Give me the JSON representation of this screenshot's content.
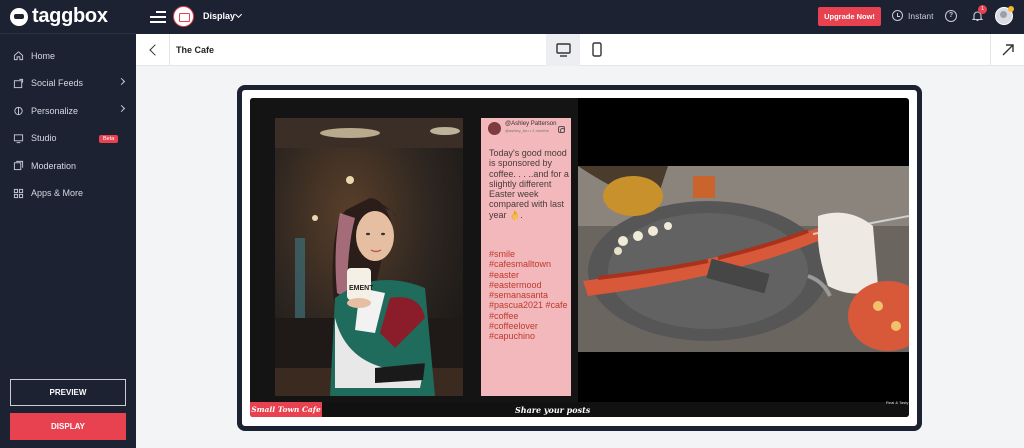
{
  "app": {
    "logo_text": "taggbox"
  },
  "sidebar": {
    "items": [
      {
        "label": "Home",
        "icon": "home-icon"
      },
      {
        "label": "Social Feeds",
        "icon": "social-feeds-icon",
        "has_arrow": true
      },
      {
        "label": "Personalize",
        "icon": "personalize-icon",
        "has_arrow": true
      },
      {
        "label": "Studio",
        "icon": "studio-icon",
        "badge": "Beta"
      },
      {
        "label": "Moderation",
        "icon": "moderation-icon"
      },
      {
        "label": "Apps & More",
        "icon": "apps-icon"
      }
    ],
    "preview_label": "PREVIEW",
    "display_label": "DISPLAY"
  },
  "topbar": {
    "context_label": "Display",
    "upgrade_label": "Upgrade Now!",
    "instant_label": "Instant",
    "help_label": "?",
    "notification_count": "1"
  },
  "subbar": {
    "title": "The Cafe"
  },
  "post": {
    "author": "@Ashley Patterson",
    "meta": "@ashley_bru • 2 months",
    "caption": "Today's good mood is sponsored by coffee. . . ..and for a slightly different Easter week compared with last year 👌.",
    "hashtags": "#smile #cafesmalltown #easter #eastermood #semanasanta #pascua2021 #cafe #coffee #coffeelover #capuchino",
    "mug_text": "EMENT"
  },
  "footer": {
    "brand": "Small Town Cafe",
    "share": "Share your posts",
    "corner_logo": "Real & Tasty"
  },
  "colors": {
    "sidebar_bg": "#1d2233",
    "accent": "#e8414f",
    "post_text_bg": "#f2b8bb",
    "hashtag": "#c0392b"
  }
}
